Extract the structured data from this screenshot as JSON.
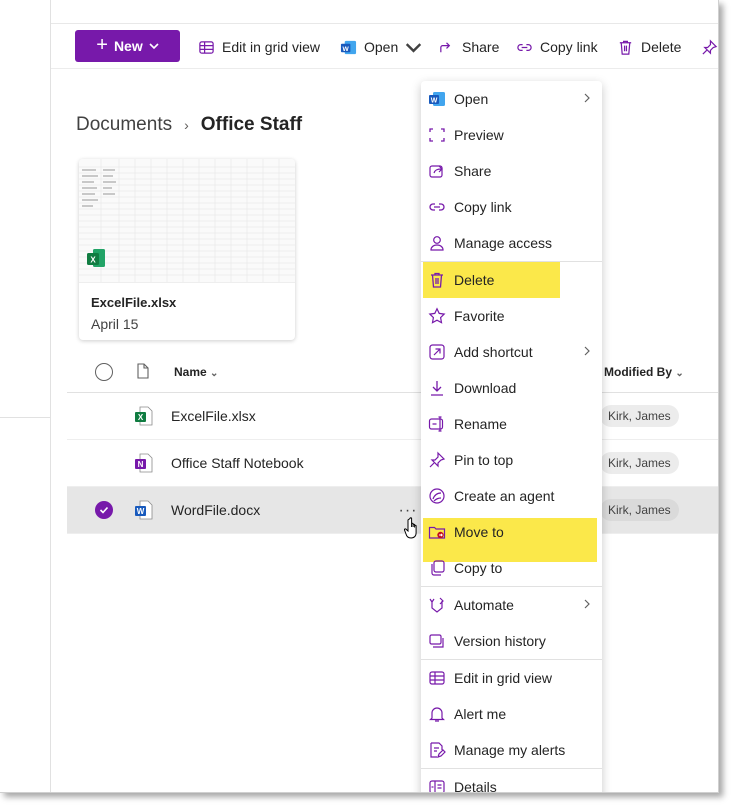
{
  "toolbar": {
    "new_label": "New",
    "edit_grid_label": "Edit in grid view",
    "open_label": "Open",
    "share_label": "Share",
    "copy_link_label": "Copy link",
    "delete_label": "Delete"
  },
  "breadcrumb": {
    "parent": "Documents",
    "separator": "›",
    "current": "Office Staff"
  },
  "tile": {
    "name": "ExcelFile.xlsx",
    "date": "April 15"
  },
  "list": {
    "columns": {
      "name": "Name",
      "modified_by": "Modified By"
    },
    "rows": [
      {
        "name": "ExcelFile.xlsx",
        "type": "excel-icon",
        "modified_by": "Kirk, James",
        "selected": false
      },
      {
        "name": "Office Staff Notebook",
        "type": "onenote-icon",
        "modified_by": "Kirk, James",
        "selected": false
      },
      {
        "name": "WordFile.docx",
        "type": "word-icon",
        "modified_by": "Kirk, James",
        "selected": true
      }
    ],
    "more_label": "···"
  },
  "context_menu": {
    "items": [
      {
        "label": "Open",
        "icon": "word-icon",
        "submenu": true
      },
      {
        "label": "Preview",
        "icon": "preview-icon"
      },
      {
        "label": "Share",
        "icon": "share-icon"
      },
      {
        "label": "Copy link",
        "icon": "link-icon"
      },
      {
        "label": "Manage access",
        "icon": "person-icon"
      },
      {
        "label": "Delete",
        "icon": "trash-icon",
        "highlighted": true
      },
      {
        "label": "Favorite",
        "icon": "star-icon"
      },
      {
        "label": "Add shortcut",
        "icon": "shortcut-icon",
        "submenu": true
      },
      {
        "label": "Download",
        "icon": "download-icon"
      },
      {
        "label": "Rename",
        "icon": "rename-icon"
      },
      {
        "label": "Pin to top",
        "icon": "pin-icon"
      },
      {
        "label": "Create an agent",
        "icon": "agent-icon"
      },
      {
        "label": "Move to",
        "icon": "move-folder-icon",
        "highlighted": true
      },
      {
        "label": "Copy to",
        "icon": "copy-icon"
      },
      {
        "label": "Automate",
        "icon": "automate-icon",
        "submenu": true
      },
      {
        "label": "Version history",
        "icon": "version-history-icon"
      },
      {
        "label": "Edit in grid view",
        "icon": "grid-icon"
      },
      {
        "label": "Alert me",
        "icon": "bell-icon"
      },
      {
        "label": "Manage my alerts",
        "icon": "alerts-edit-icon"
      },
      {
        "label": "Details",
        "icon": "details-icon"
      }
    ]
  },
  "colors": {
    "accent": "#7719aa",
    "highlight": "#fbe84a"
  }
}
